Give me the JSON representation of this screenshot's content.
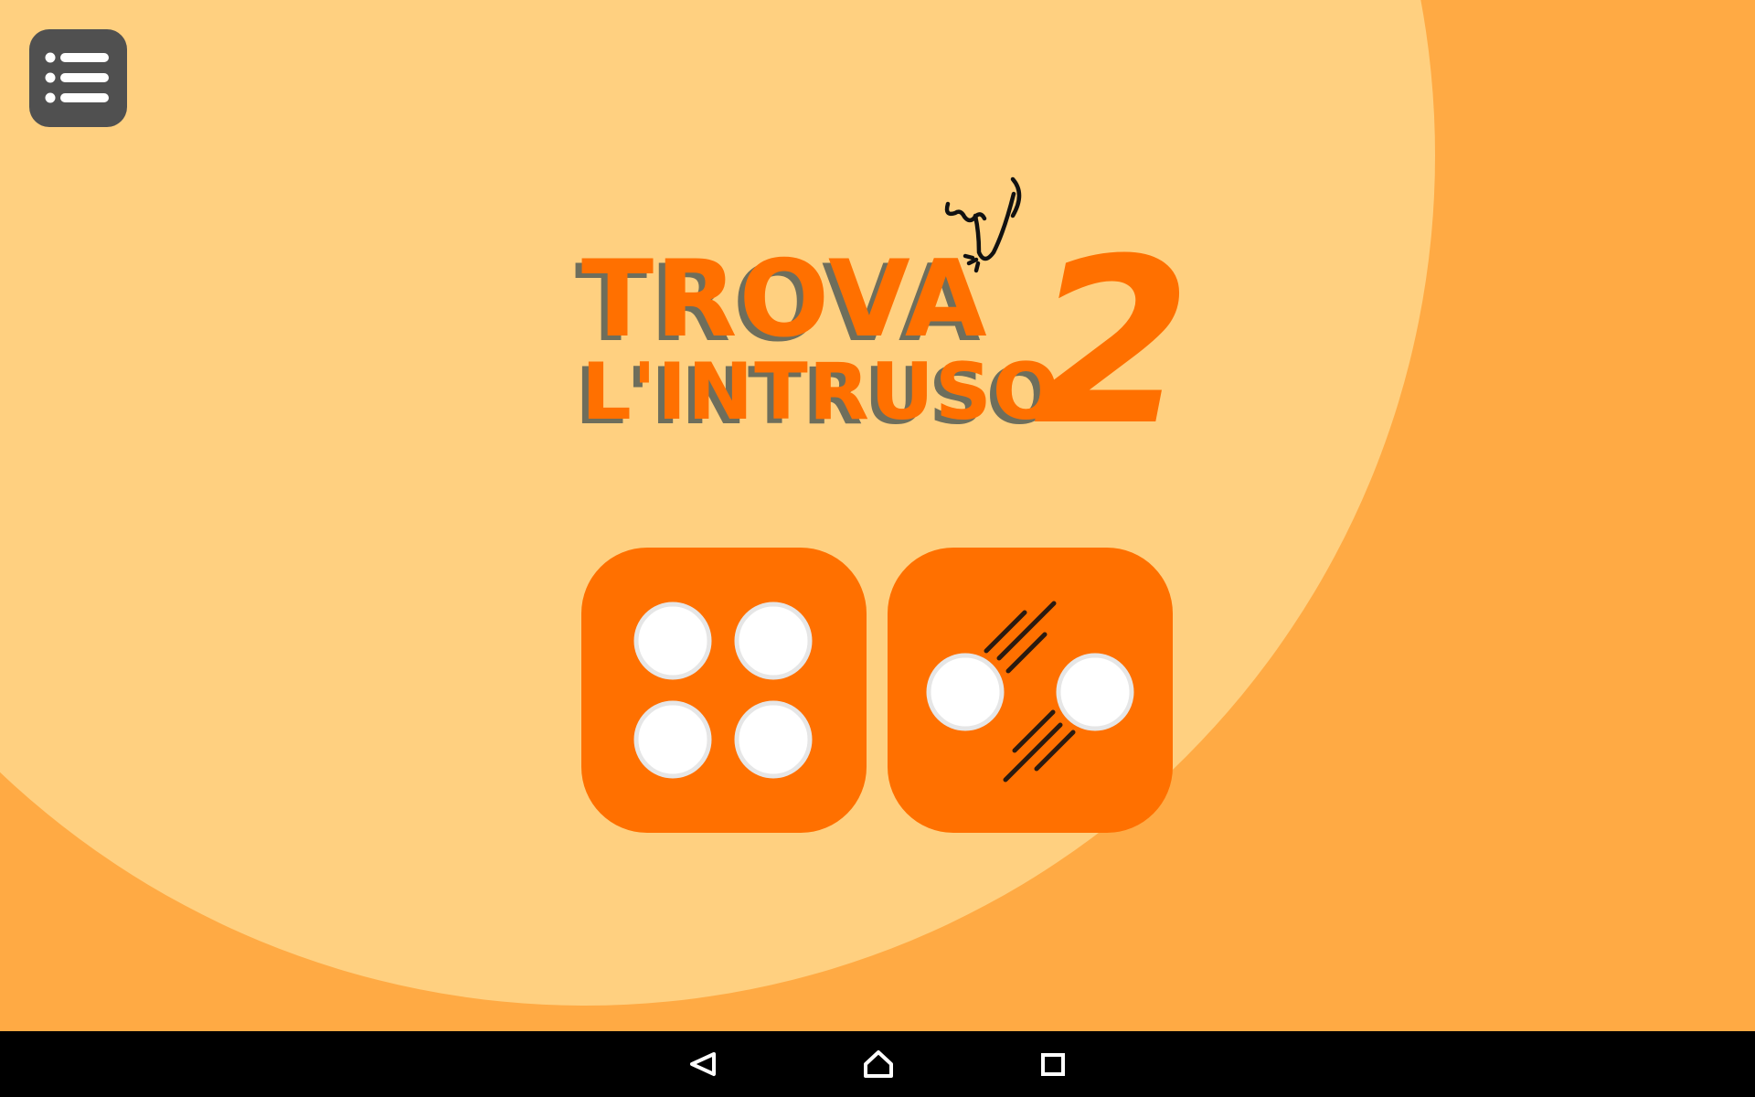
{
  "app": {
    "title_line1": "TROVA",
    "title_line2": "L'INTRUSO",
    "title_number": "2"
  },
  "colors": {
    "background_outer": "#ffaa44",
    "background_circle": "#ffd080",
    "accent_orange": "#ff7000",
    "menu_button": "#505050",
    "title_shadow": "#6e6e5c",
    "dot_fill": "#ffffff",
    "dot_ring": "#e6e6e6",
    "motion_lines": "#2a1a10",
    "nav_bar": "#000000"
  },
  "menu_button": {
    "icon": "list-menu-icon"
  },
  "modes": [
    {
      "icon": "four-dots-icon",
      "dots": 4
    },
    {
      "icon": "two-dots-moving-icon",
      "dots": 2
    }
  ],
  "navigation_bar": {
    "buttons": [
      {
        "icon": "back-triangle-icon"
      },
      {
        "icon": "home-icon"
      },
      {
        "icon": "recents-square-icon"
      }
    ]
  }
}
